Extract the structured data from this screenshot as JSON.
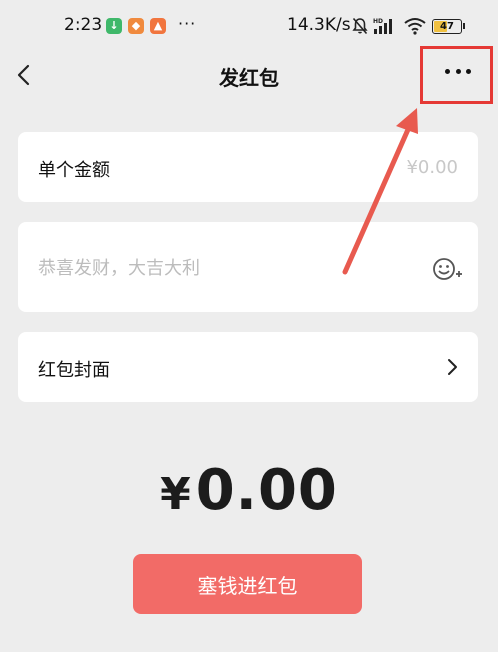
{
  "status_bar": {
    "time": "2:23",
    "app_icons": [
      "app-notification-icon",
      "app-notification-icon",
      "app-notification-icon"
    ],
    "more_indicator": "···",
    "network_speed": "14.3K/s",
    "battery_level": "47"
  },
  "nav": {
    "title": "发红包"
  },
  "amount_row": {
    "label": "单个金额",
    "placeholder": "¥0.00"
  },
  "greeting": {
    "placeholder": "恭喜发财，大吉大利"
  },
  "cover_row": {
    "label": "红包封面"
  },
  "total": {
    "currency": "¥",
    "value": "0.00"
  },
  "submit_button": {
    "label": "塞钱进红包"
  },
  "colors": {
    "background": "#ededed",
    "card": "#ffffff",
    "submit": "#f26b67",
    "highlight": "#e53935"
  }
}
